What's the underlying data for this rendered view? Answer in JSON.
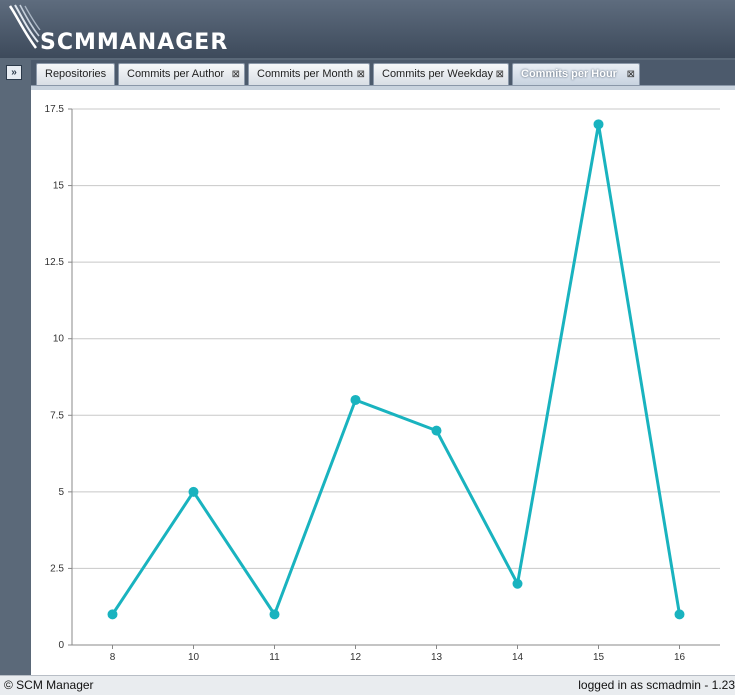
{
  "header": {
    "logo_text": "SCMMANAGER"
  },
  "tabs": [
    {
      "label": "Repositories",
      "closable": false,
      "active": false
    },
    {
      "label": "Commits per Author",
      "closable": true,
      "active": false
    },
    {
      "label": "Commits per Month",
      "closable": true,
      "active": false
    },
    {
      "label": "Commits per Weekday",
      "closable": true,
      "active": false
    },
    {
      "label": "Commits per Hour",
      "closable": true,
      "active": true
    }
  ],
  "close_glyph": "⊠",
  "chart_data": {
    "type": "line",
    "x": [
      8,
      10,
      11,
      12,
      13,
      14,
      15,
      16
    ],
    "categories": [
      "8",
      "10",
      "11",
      "12",
      "13",
      "14",
      "15",
      "16"
    ],
    "values": [
      1,
      5,
      1,
      8,
      7,
      2,
      17,
      1
    ],
    "ylim": [
      0,
      17.5
    ],
    "yticks": [
      0,
      2.5,
      5,
      7.5,
      10,
      12.5,
      15,
      17.5
    ],
    "ytick_labels": [
      "0",
      "2.5",
      "5",
      "7.5",
      "10",
      "12.5",
      "15",
      "17.5"
    ],
    "grid": true,
    "series_color": "#19b3bf",
    "title": "",
    "xlabel": "",
    "ylabel": ""
  },
  "footer": {
    "copyright": "© SCM Manager",
    "login_status": "logged in as scmadmin - 1.23"
  }
}
